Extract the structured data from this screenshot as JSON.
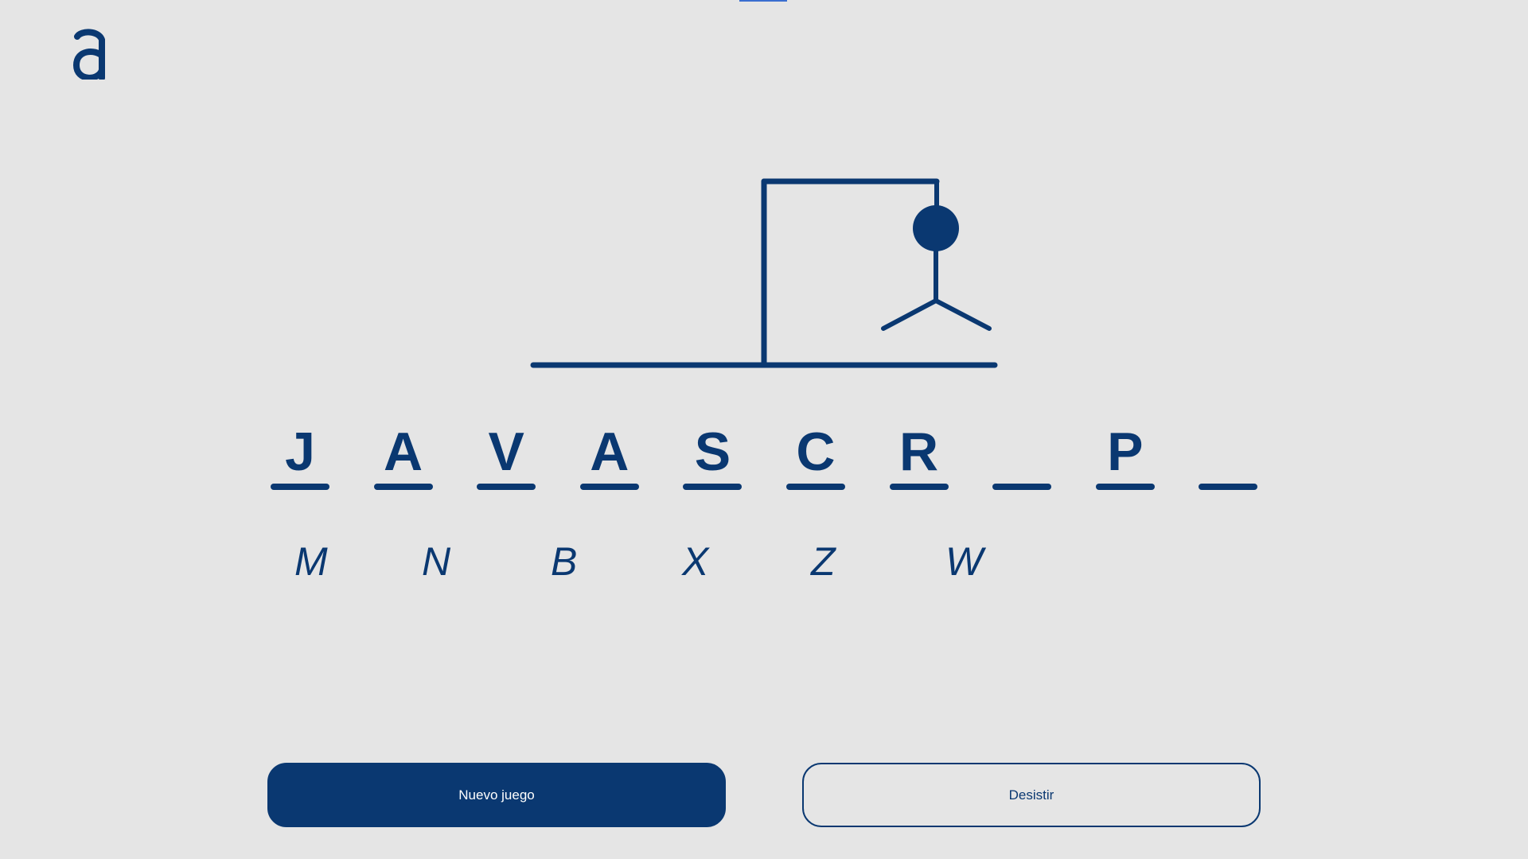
{
  "colors": {
    "background": "#e5e5e5",
    "primary": "#0a3871",
    "accent_indicator": "#3a6ed0",
    "button_text_light": "#ffffff"
  },
  "logo": {
    "icon": "alura-a-logo-icon"
  },
  "game": {
    "word_slots": [
      "J",
      "A",
      "V",
      "A",
      "S",
      "C",
      "R",
      "",
      "P",
      ""
    ],
    "wrong_letters": [
      "M",
      "N",
      "B",
      "X",
      "Z",
      "W"
    ],
    "hangman_parts_shown": [
      "head",
      "body",
      "left-arm",
      "right-arm"
    ]
  },
  "buttons": {
    "new_game_label": "Nuevo juego",
    "give_up_label": "Desistir"
  }
}
